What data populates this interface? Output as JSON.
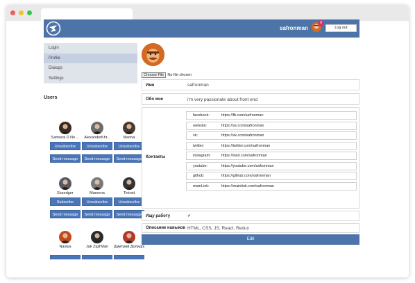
{
  "header": {
    "username": "safronman",
    "notification_count": "0",
    "logout_label": "Log out",
    "brand_color": "#4c74a8"
  },
  "nav": {
    "items": [
      {
        "label": "Login"
      },
      {
        "label": "Profile"
      },
      {
        "label": "Dialogs"
      },
      {
        "label": "Settings"
      }
    ],
    "active": "Profile"
  },
  "users": {
    "title": "Users",
    "list": [
      {
        "name": "Samurai D Ne ...",
        "button": "Unsubscribe"
      },
      {
        "name": "AlexanderKhr...",
        "button": "Unsubscribe"
      },
      {
        "name": "Marina",
        "button": "Unsubscribe"
      },
      {
        "name": "Essedger",
        "button": "Subscribe"
      },
      {
        "name": "Mareena",
        "button": "Unsubscribe"
      },
      {
        "name": "Tiniroit",
        "button": "Unsubscribe"
      },
      {
        "name": "Nastya",
        "button": ""
      },
      {
        "name": "Jak Zigil'Man",
        "button": ""
      },
      {
        "name": "Дмитрий Долидов",
        "button": ""
      }
    ],
    "send_message_label": "Send message"
  },
  "profile": {
    "choose_file_label": "Choose File",
    "no_file_label": "No file chosen",
    "name_label": "Имя",
    "name_value": "safronman",
    "about_label": "Обо мне",
    "about_value": "i'm very passionate about front end",
    "contacts_label": "Контакты",
    "contacts": [
      {
        "key": "facebook:",
        "value": "https://fb.com/safronman"
      },
      {
        "key": "website:",
        "value": "https://vs.com/safronman"
      },
      {
        "key": "vk:",
        "value": "https://vk.com/safronman"
      },
      {
        "key": "twitter:",
        "value": "https://twitter.com/safronman"
      },
      {
        "key": "instagram:",
        "value": "https://insit.com/safronman"
      },
      {
        "key": "youtube:",
        "value": "https://youtube.com/safronman"
      },
      {
        "key": "github:",
        "value": "https://github.com/safronman"
      },
      {
        "key": "mainLink:",
        "value": "https://mainlink.com/safronman"
      }
    ],
    "job_label": "Ищу работу",
    "job_check": "✔",
    "skills_label": "Описание навыков",
    "skills_value": "HTML, CSS, JS, React, Redux",
    "edit_label": "Edit"
  }
}
